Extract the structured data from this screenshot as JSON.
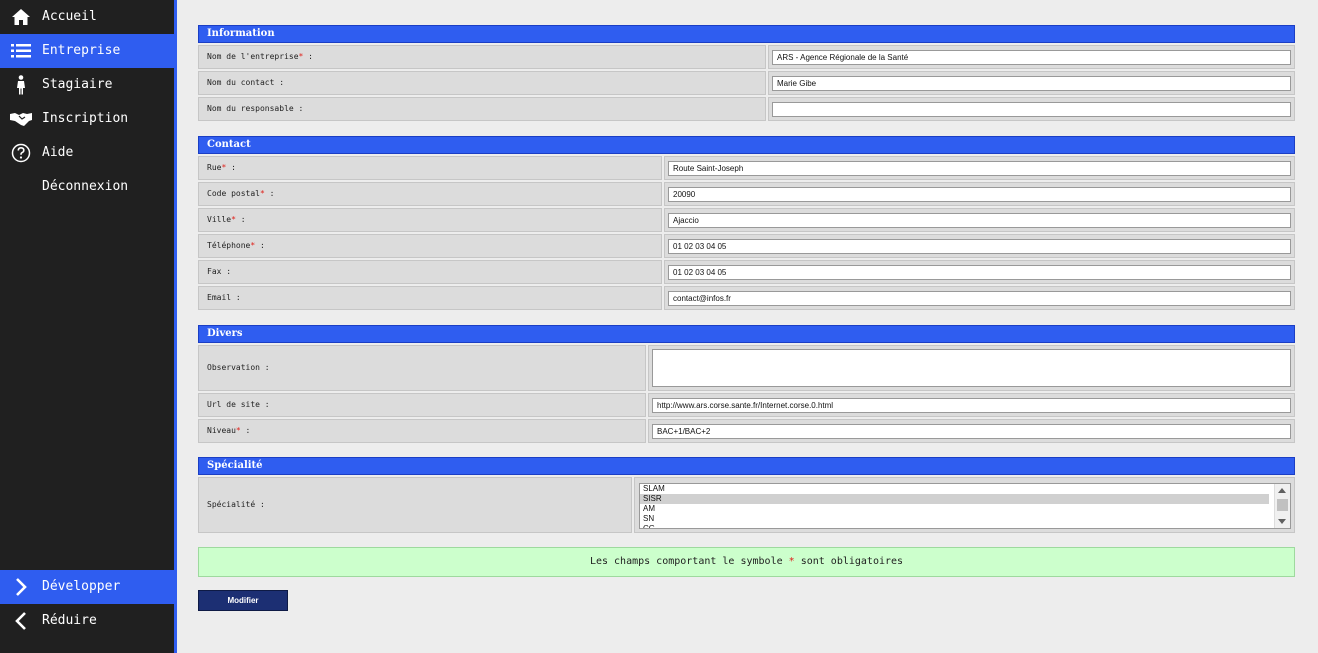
{
  "sidebar": {
    "items": [
      {
        "label": "Accueil",
        "icon": "home-icon"
      },
      {
        "label": "Entreprise",
        "icon": "list-icon",
        "active": true
      },
      {
        "label": "Stagiaire",
        "icon": "person-icon"
      },
      {
        "label": "Inscription",
        "icon": "handshake-icon"
      },
      {
        "label": "Aide",
        "icon": "help-icon"
      },
      {
        "label": "Déconnexion",
        "icon": ""
      }
    ],
    "bottom": [
      {
        "label": "Développer",
        "icon": "chevron-right-icon",
        "active": true
      },
      {
        "label": "Réduire",
        "icon": "chevron-left-icon"
      }
    ]
  },
  "sections": {
    "information": {
      "title": "Information",
      "fields": [
        {
          "label": "Nom de l'entreprise",
          "required": true,
          "value": "ARS - Agence Régionale de la Santé"
        },
        {
          "label": "Nom du contact",
          "required": false,
          "value": "Marie Gibe"
        },
        {
          "label": "Nom du responsable",
          "required": false,
          "value": ""
        }
      ]
    },
    "contact": {
      "title": "Contact",
      "fields": [
        {
          "label": "Rue",
          "required": true,
          "value": "Route Saint-Joseph"
        },
        {
          "label": "Code postal",
          "required": true,
          "value": "20090"
        },
        {
          "label": "Ville",
          "required": true,
          "value": "Ajaccio"
        },
        {
          "label": "Téléphone",
          "required": true,
          "value": "01 02 03 04 05"
        },
        {
          "label": "Fax",
          "required": false,
          "value": "01 02 03 04 05"
        },
        {
          "label": "Email",
          "required": false,
          "value": "contact@infos.fr"
        }
      ]
    },
    "divers": {
      "title": "Divers",
      "fields": [
        {
          "label": "Observation",
          "required": false,
          "value": ""
        },
        {
          "label": "Url de site",
          "required": false,
          "value": "http://www.ars.corse.sante.fr/Internet.corse.0.html"
        },
        {
          "label": "Niveau",
          "required": true,
          "value": "BAC+1/BAC+2"
        }
      ]
    },
    "specialite": {
      "title": "Spécialité",
      "label": "Spécialité",
      "options": [
        "SLAM",
        "SISR",
        "AM",
        "SN",
        "CG"
      ],
      "selected": "SISR"
    }
  },
  "notice": {
    "before": "Les champs comportant le symbole ",
    "symbol": "*",
    "after": " sont obligatoires"
  },
  "submit_label": "Modifier",
  "colors": {
    "accent": "#2f5df0",
    "sidebar": "#202020",
    "required": "#e0201a",
    "notice_bg": "#ccffcc",
    "button": "#1c2f73"
  }
}
